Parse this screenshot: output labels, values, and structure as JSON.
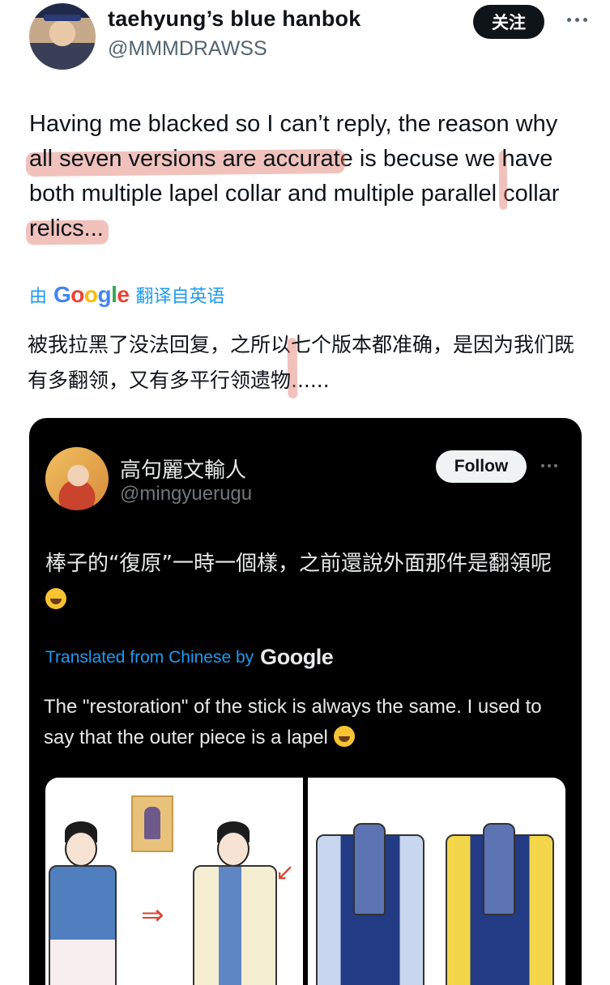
{
  "header": {
    "display_name": "taehyung’s blue hanbok",
    "handle": "@MMMDRAWSS",
    "follow_label": "关注"
  },
  "tweet": {
    "text_parts": [
      "Having me blacked so I can’t reply, the reason why ",
      "all seven versions are accurat",
      "e is becuse we ",
      "have both m",
      "ultiple lapel collar and multiple parallel collar ",
      "relics..."
    ]
  },
  "translation": {
    "by_prefix": "由",
    "by_suffix": "翻译自英语",
    "text_parts": [
      "被我拉黑了没法回复，之所以",
      "七个版本都准确，是因为我们既有多翻领，又有多平行领遗物",
      "......"
    ]
  },
  "quote": {
    "name": "高句麗文輸人",
    "handle": "@mingyuerugu",
    "follow_label": "Follow",
    "text": "棒子的“復原”一時一個樣，之前還說外面那件是翻領呢",
    "translated_label": "Translated from Chinese by",
    "translation": "The \"restoration\" of the stick is always the same. I used to say that the outer piece is a lapel"
  },
  "google_logo": [
    "G",
    "o",
    "o",
    "g",
    "l",
    "e"
  ],
  "colors": {
    "link_blue": "#1d9bf0",
    "highlight": "#de6e5f",
    "card_bg": "#000000"
  },
  "icons": [
    "more-icon",
    "laughing-emoji-icon",
    "google-logo"
  ]
}
